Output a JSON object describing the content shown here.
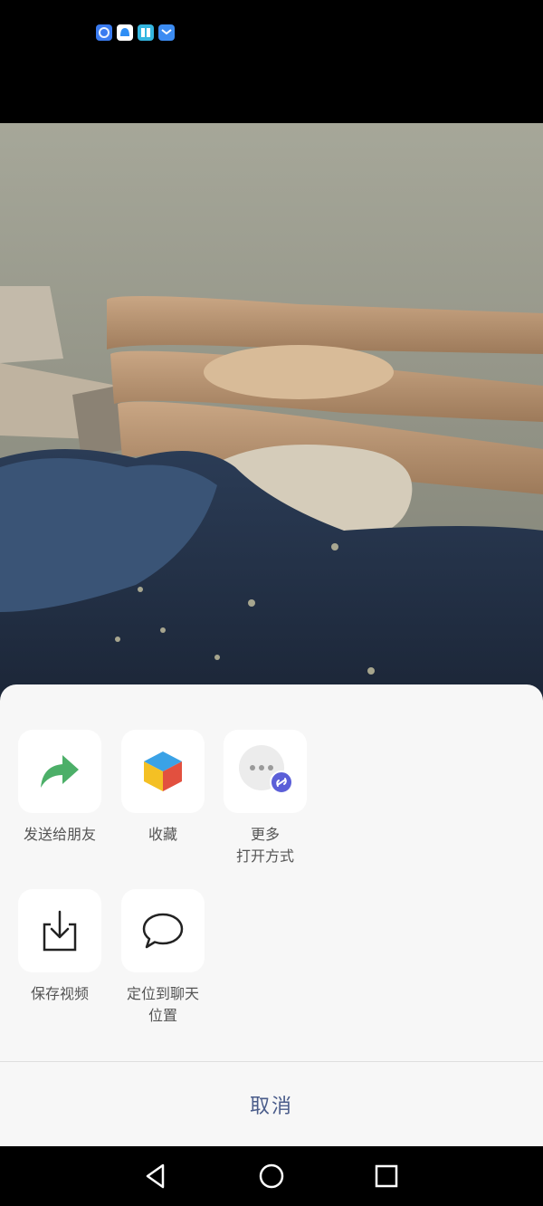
{
  "status_bar": {
    "icons": [
      {
        "name": "app-notification-icon-1",
        "color": "#3a7bf0"
      },
      {
        "name": "app-notification-icon-2",
        "color": "#2f8ef5"
      },
      {
        "name": "app-notification-icon-3",
        "color": "#34b6e0"
      },
      {
        "name": "app-notification-icon-4",
        "color": "#3c8cf2"
      }
    ]
  },
  "photo": {
    "description_icon": "bedroom-photo"
  },
  "share_sheet": {
    "actions": [
      {
        "label": "发送给朋友",
        "icon": "share-forward-icon"
      },
      {
        "label": "收藏",
        "icon": "favorite-cube-icon"
      },
      {
        "label": "更多\n打开方式",
        "icon": "more-open-with-icon"
      },
      {
        "label": "保存视频",
        "icon": "save-download-icon"
      },
      {
        "label": "定位到聊天\n位置",
        "icon": "chat-bubble-icon"
      }
    ],
    "cancel_label": "取消"
  },
  "nav_bar": {
    "buttons": [
      "back-icon",
      "home-icon",
      "recents-icon"
    ]
  },
  "colors": {
    "accent_green": "#4caf68",
    "mini_program_badge": "#5b5fd8",
    "cancel_text": "#4a5c8a"
  }
}
